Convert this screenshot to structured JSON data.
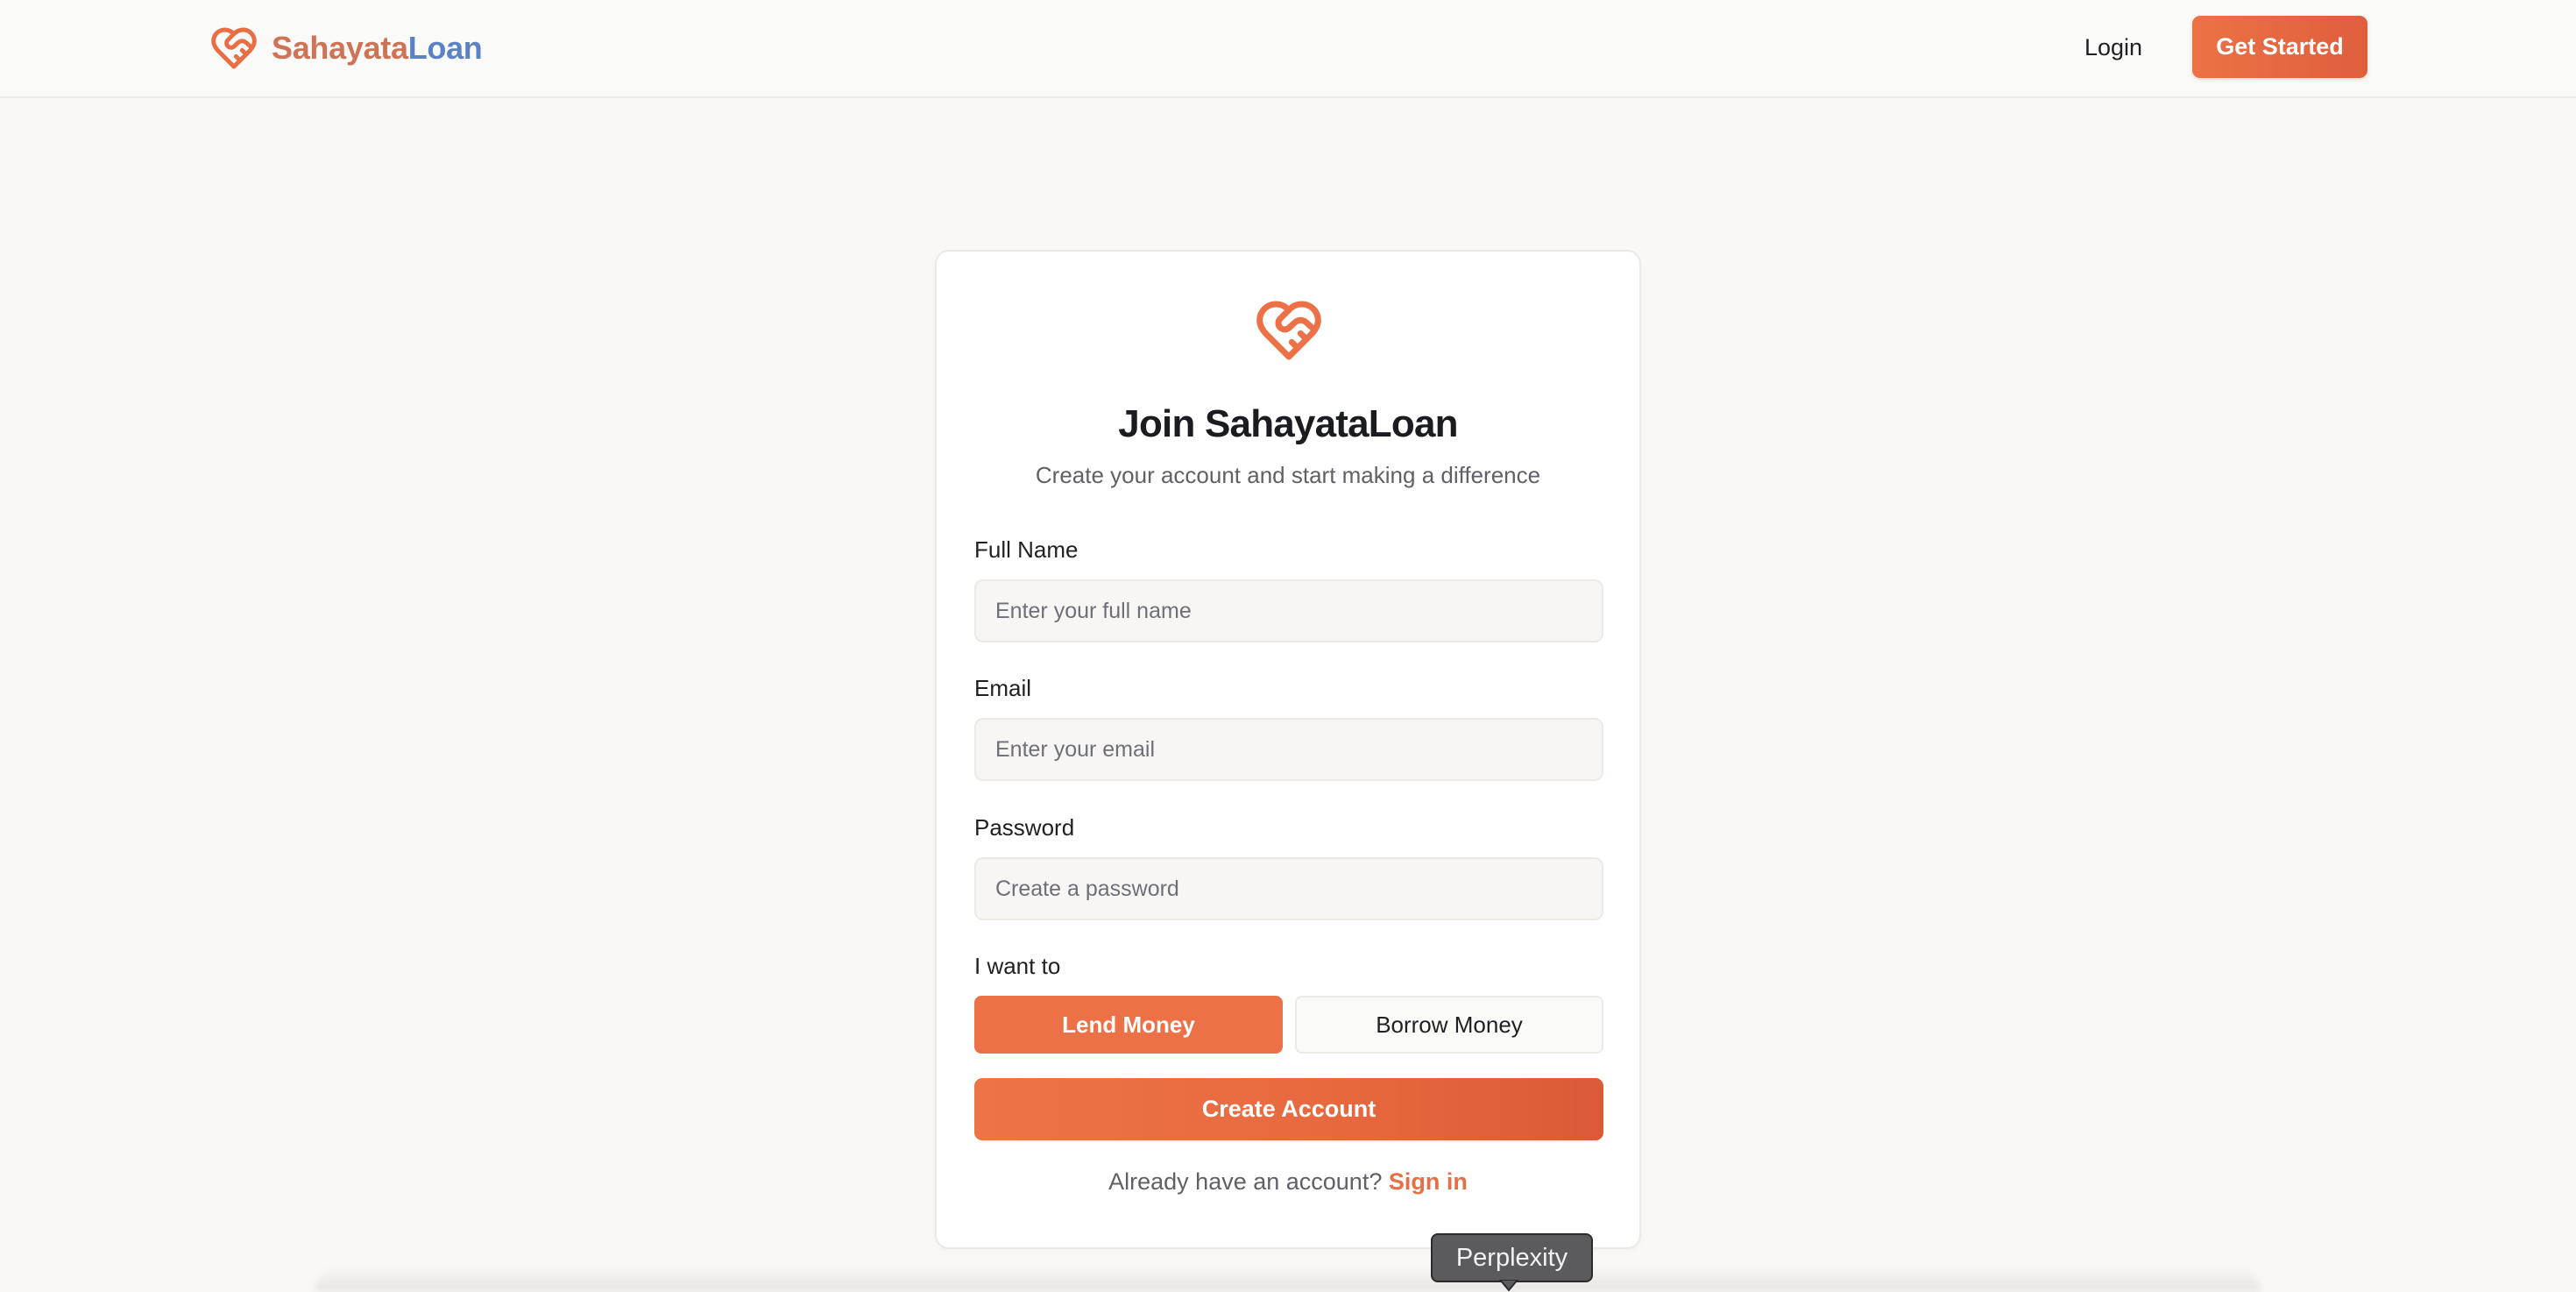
{
  "header": {
    "brand_part1": "Sahayata",
    "brand_part2": "Loan",
    "login_label": "Login",
    "cta_label": "Get Started"
  },
  "form": {
    "title": "Join SahayataLoan",
    "subtitle": "Create your account and start making a difference",
    "full_name_label": "Full Name",
    "full_name_placeholder": "Enter your full name",
    "full_name_value": "",
    "email_label": "Email",
    "email_placeholder": "Enter your email",
    "email_value": "",
    "password_label": "Password",
    "password_placeholder": "Create a password",
    "password_value": "",
    "role_label": "I want to",
    "role_options": [
      "Lend Money",
      "Borrow Money"
    ],
    "role_selected": "Lend Money",
    "submit_label": "Create Account",
    "signin_prompt": "Already have an account?",
    "signin_link": "Sign in"
  },
  "tooltip": {
    "label": "Perplexity"
  },
  "colors": {
    "accent": "#ec7147",
    "accent_dark": "#dc5937",
    "brand_blue": "#5b82c5",
    "page_bg": "#f9f8f6"
  },
  "icons": {
    "brand": "heart-handshake-icon"
  }
}
